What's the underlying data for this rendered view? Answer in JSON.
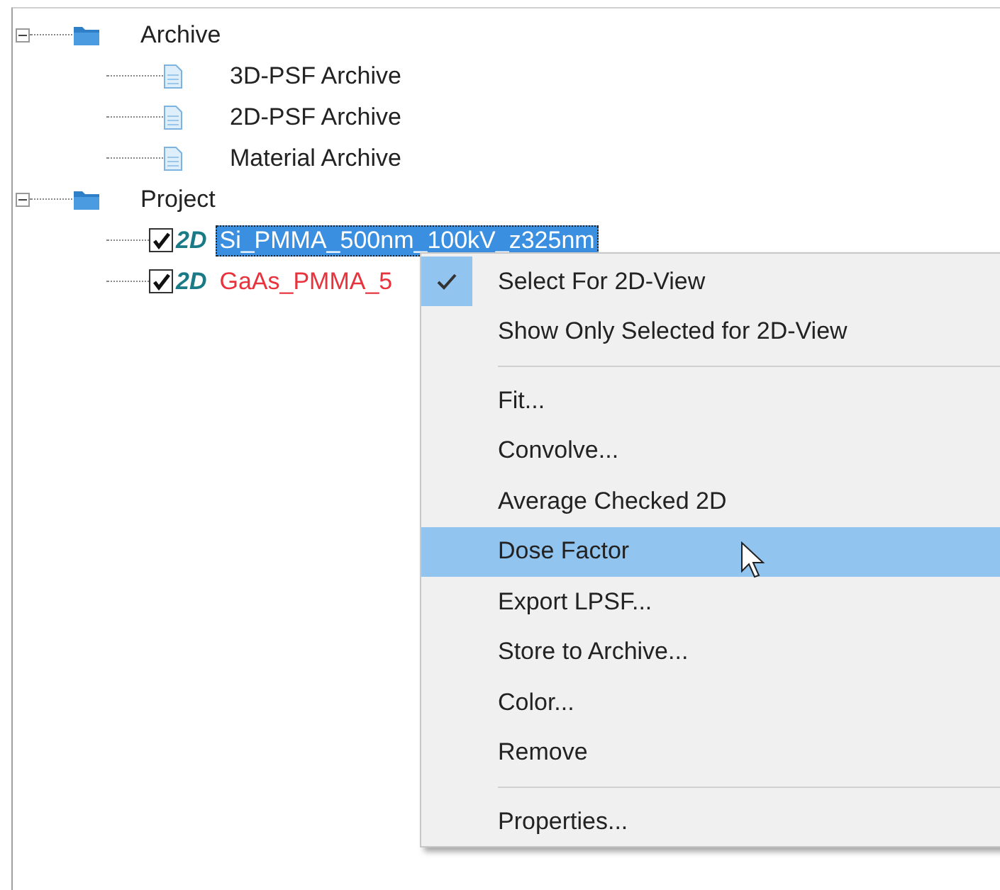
{
  "tree": [
    {
      "label": "Archive",
      "kind": "folder",
      "expanded": true,
      "children": [
        {
          "label": "3D-PSF Archive",
          "kind": "document"
        },
        {
          "label": "2D-PSF Archive",
          "kind": "document"
        },
        {
          "label": "Material Archive",
          "kind": "document"
        }
      ]
    },
    {
      "label": "Project",
      "kind": "folder",
      "expanded": true,
      "children": [
        {
          "label": "Si_PMMA_500nm_100kV_z325nm",
          "kind": "dataset",
          "icon_text": "2D",
          "checked": true,
          "selected": true
        },
        {
          "label": "GaAs_PMMA_5",
          "kind": "dataset",
          "icon_text": "2D",
          "checked": true,
          "selected": false,
          "color": "#e8323c"
        }
      ]
    }
  ],
  "context_menu": [
    {
      "kind": "item",
      "label": "Select For 2D-View",
      "checked": true,
      "selected": false
    },
    {
      "kind": "item",
      "label": "Show Only Selected for 2D-View",
      "checked": false,
      "selected": false
    },
    {
      "kind": "separator"
    },
    {
      "kind": "item",
      "label": "Fit...",
      "checked": false,
      "selected": false
    },
    {
      "kind": "item",
      "label": "Convolve...",
      "checked": false,
      "selected": false
    },
    {
      "kind": "item",
      "label": "Average Checked 2D",
      "checked": false,
      "selected": false
    },
    {
      "kind": "item",
      "label": "Dose Factor",
      "checked": false,
      "selected": true
    },
    {
      "kind": "item",
      "label": "Export LPSF...",
      "checked": false,
      "selected": false
    },
    {
      "kind": "item",
      "label": "Store to Archive...",
      "checked": false,
      "selected": false
    },
    {
      "kind": "item",
      "label": "Color...",
      "checked": false,
      "selected": false
    },
    {
      "kind": "item",
      "label": "Remove",
      "checked": false,
      "selected": false
    },
    {
      "kind": "separator"
    },
    {
      "kind": "item",
      "label": "Properties...",
      "checked": false,
      "selected": false
    }
  ]
}
